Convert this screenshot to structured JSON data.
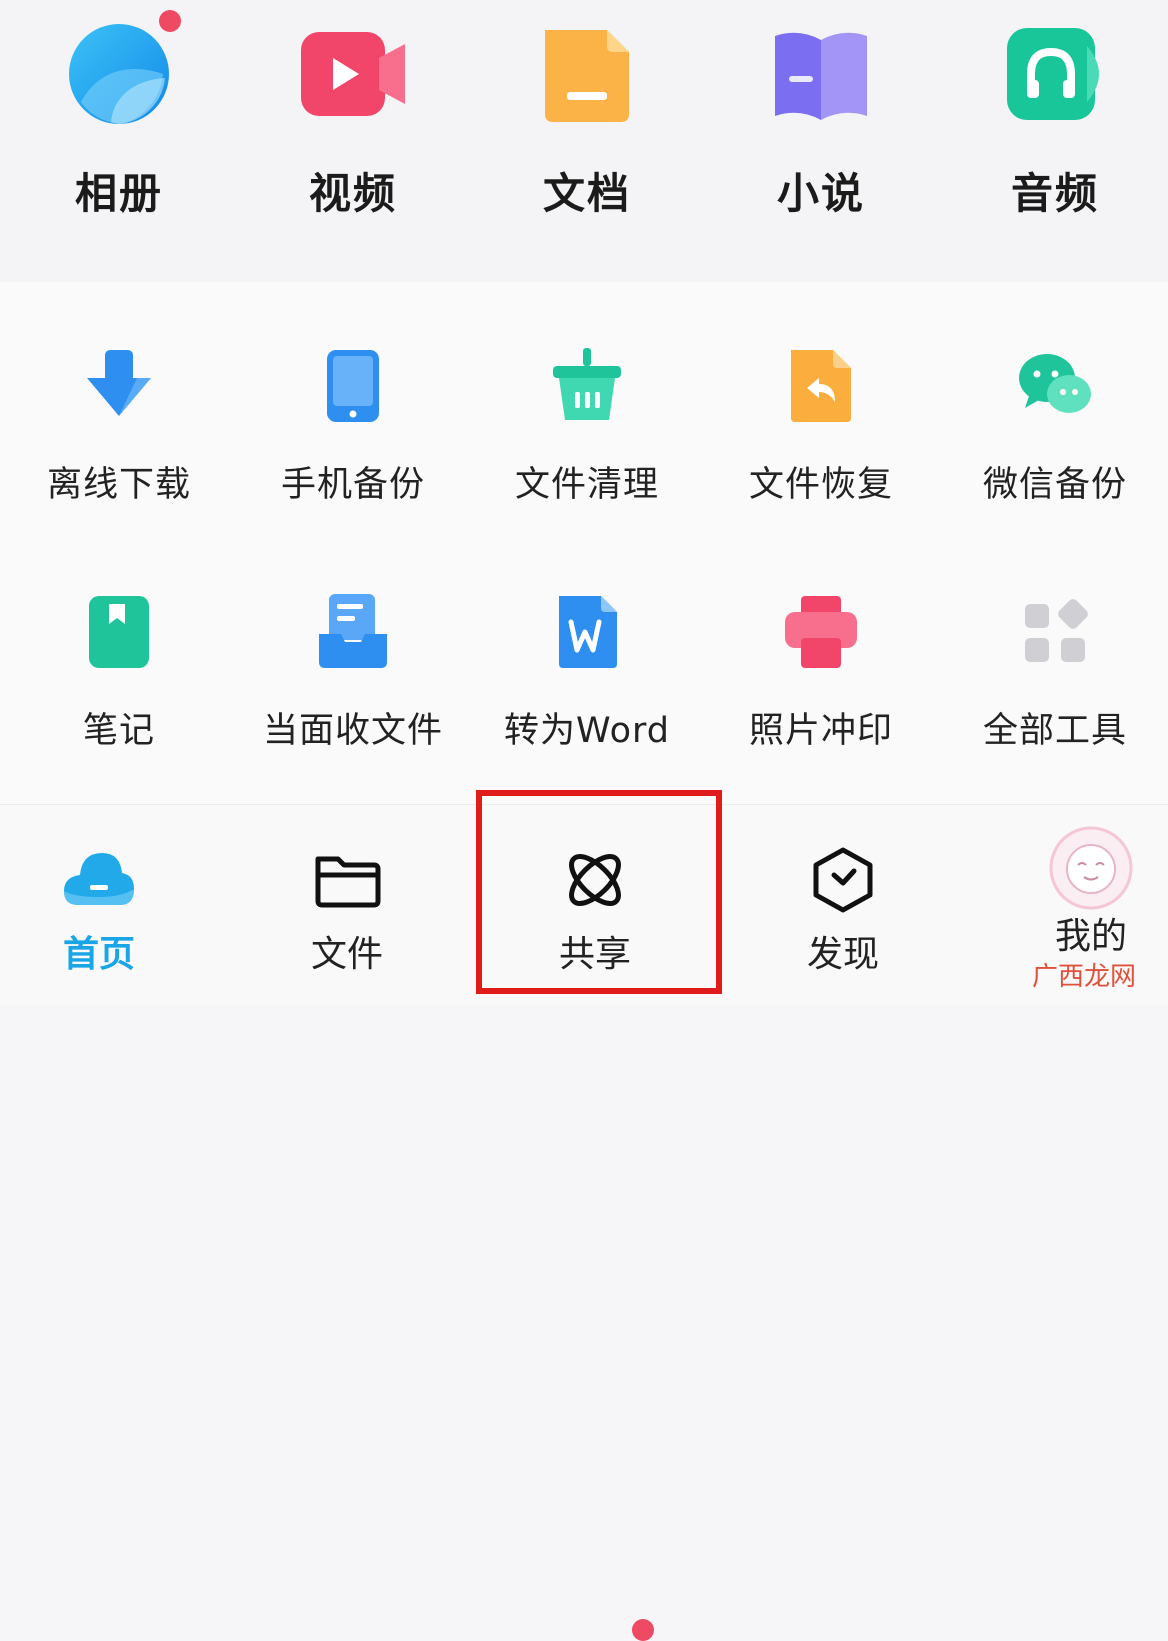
{
  "categories": [
    {
      "label": "相册",
      "icon": "album-icon"
    },
    {
      "label": "视频",
      "icon": "video-icon"
    },
    {
      "label": "文档",
      "icon": "document-icon"
    },
    {
      "label": "小说",
      "icon": "novel-book-icon"
    },
    {
      "label": "音频",
      "icon": "audio-headphone-icon"
    }
  ],
  "tools_row1": [
    {
      "label": "离线下载",
      "icon": "download-arrow-icon"
    },
    {
      "label": "手机备份",
      "icon": "phone-backup-icon"
    },
    {
      "label": "文件清理",
      "icon": "cleanup-basket-icon"
    },
    {
      "label": "文件恢复",
      "icon": "file-restore-icon"
    },
    {
      "label": "微信备份",
      "icon": "wechat-icon"
    }
  ],
  "tools_row2": [
    {
      "label": "笔记",
      "icon": "note-icon"
    },
    {
      "label": "当面收文件",
      "icon": "receive-file-icon"
    },
    {
      "label": "转为Word",
      "icon": "word-doc-icon"
    },
    {
      "label": "照片冲印",
      "icon": "photo-print-icon"
    },
    {
      "label": "全部工具",
      "icon": "all-tools-grid-icon"
    }
  ],
  "tabbar": [
    {
      "label": "首页",
      "icon": "cloud-home-icon",
      "active": true
    },
    {
      "label": "文件",
      "icon": "folder-icon",
      "active": false
    },
    {
      "label": "共享",
      "icon": "share-orbit-icon",
      "active": false
    },
    {
      "label": "发现",
      "icon": "discover-hexagon-icon",
      "active": false
    },
    {
      "label": "我的",
      "icon": "user-avatar-icon",
      "active": false
    }
  ],
  "watermark": "广西龙网",
  "colors": {
    "accent": "#19a5e6",
    "badge": "#ef4a63",
    "highlight": "#e01b1b"
  }
}
